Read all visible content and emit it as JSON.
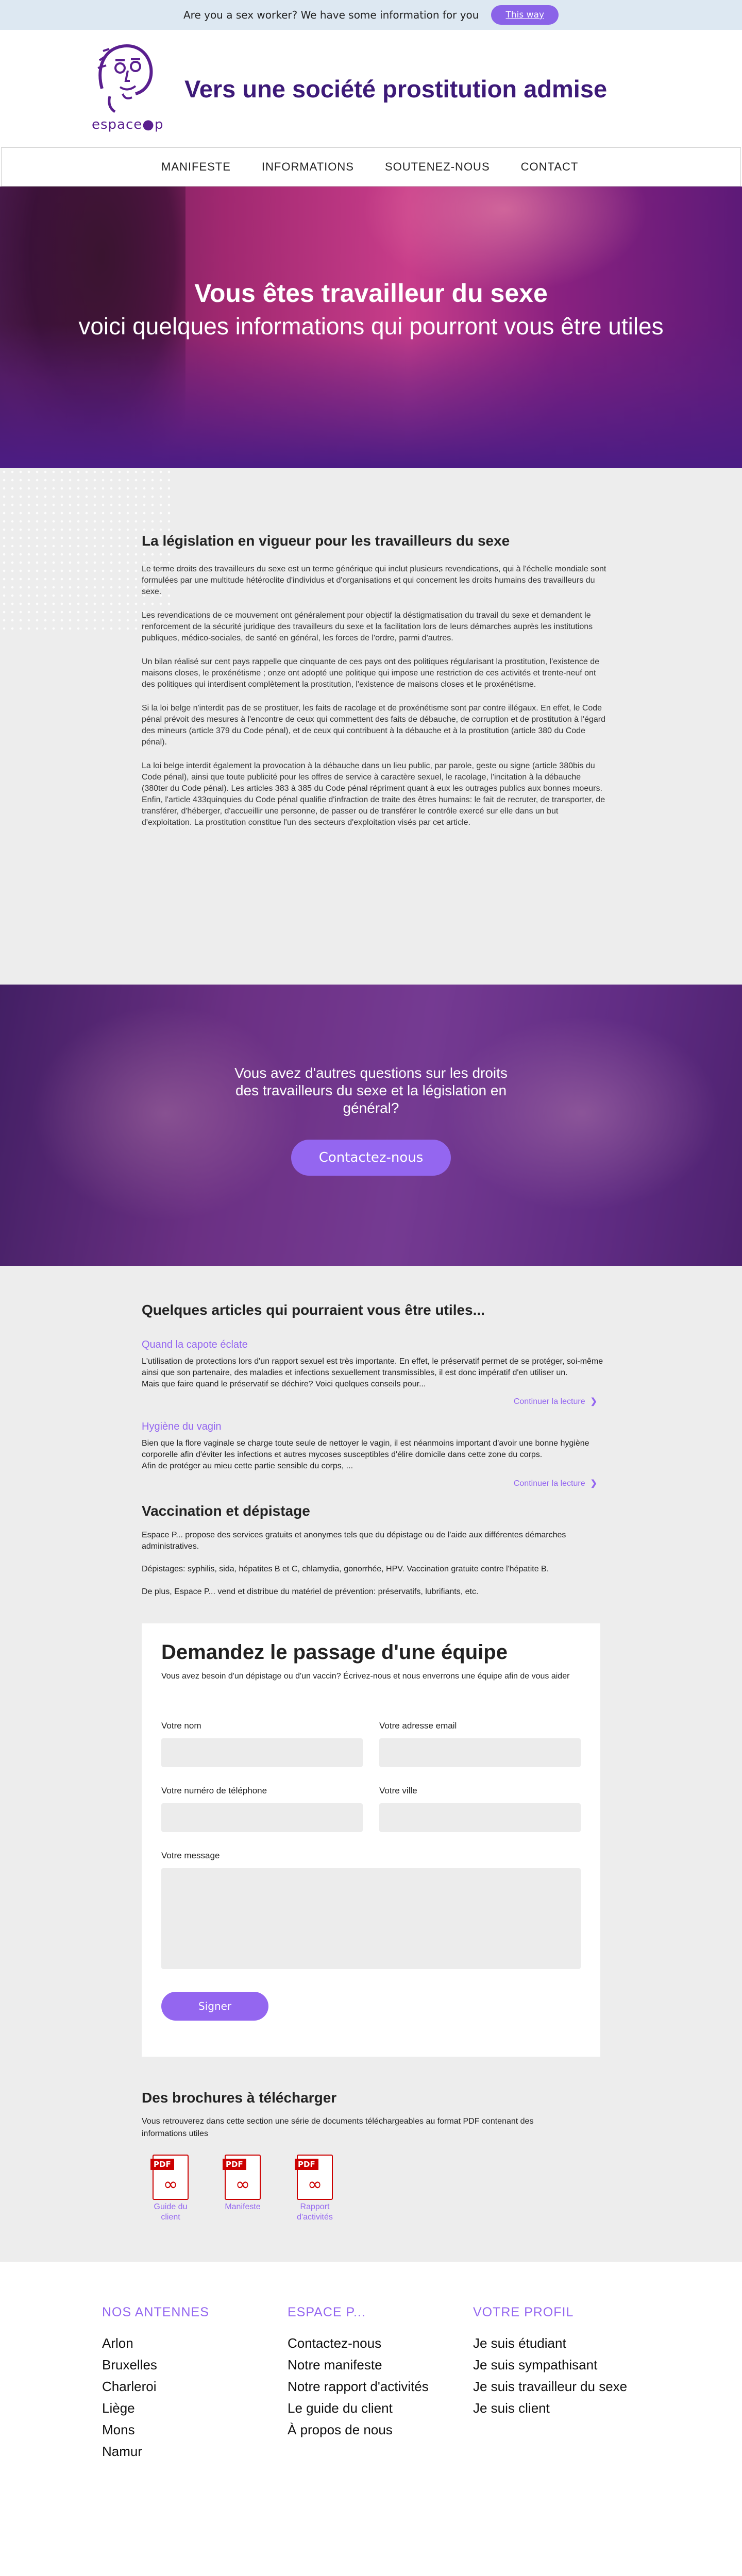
{
  "banner": {
    "text": "Are you a sex worker? We have some information for you",
    "button": "This way"
  },
  "header": {
    "logo_text": "espace●p",
    "title": "Vers une société prostitution admise"
  },
  "nav": [
    "MANIFESTE",
    "INFORMATIONS",
    "SOUTENEZ-NOUS",
    "CONTACT"
  ],
  "hero": {
    "title": "Vous êtes travailleur du sexe",
    "subtitle": "voici quelques informations qui pourront vous être utiles"
  },
  "legislation": {
    "title": "La législation en vigueur pour les travailleurs du sexe",
    "paragraphs": [
      "Le terme droits des travailleurs du sexe est un terme générique qui inclut plusieurs revendications, qui à l'échelle mondiale sont formulées par une multitude hétéroclite d'individus et d'organisations et qui concernent les droits humains des travailleurs du sexe.",
      "Les revendications de ce mouvement ont généralement pour objectif la déstigmatisation du travail du sexe et demandent le renforcement de la sécurité juridique des travailleurs du sexe et la facilitation lors de leurs démarches auprès les institutions publiques, médico-sociales, de santé en général, les forces de l'ordre, parmi d'autres.",
      "Un bilan réalisé sur cent pays rappelle que cinquante de ces pays ont des politiques régularisant la prostitution, l'existence de maisons closes, le proxénétisme ; onze ont adopté une politique qui impose une restriction de ces activités et trente-neuf ont des politiques qui interdisent complètement la prostitution, l'existence de maisons closes et le proxénétisme.",
      "Si la loi belge n'interdit pas de se prostituer, les faits de racolage et de proxénétisme sont par contre illégaux. En effet, le Code pénal prévoit des mesures à l'encontre de ceux qui commettent des faits de débauche, de corruption et de prostitution à l'égard des mineurs (article 379 du Code pénal), et de ceux qui contribuent à la débauche et à la prostitution (article 380 du Code pénal).",
      "La loi belge interdit également la provocation à la débauche dans un lieu public, par parole, geste ou signe (article 380bis du Code pénal), ainsi que toute publicité pour les offres de service à caractère sexuel, le racolage, l'incitation à la débauche (380ter du Code pénal). Les articles 383 à 385 du Code pénal répriment quant à eux les outrages publics aux bonnes moeurs. Enfin, l'article 433quinquies du Code pénal qualifie d'infraction de traite des êtres humains: le fait de recruter, de transporter, de transférer, d'héberger, d'accueillir une personne, de passer ou de transférer le contrôle exercé sur elle dans un but d'exploitation. La prostitution constitue l'un des secteurs d'exploitation visés par cet article."
    ]
  },
  "cta": {
    "text": "Vous avez d'autres questions sur les droits des travailleurs du sexe et la législation en général?",
    "button": "Contactez-nous"
  },
  "articles": {
    "title": "Quelques articles qui pourraient vous être utiles...",
    "items": [
      {
        "title": "Quand la capote éclate",
        "body": "L'utilisation de protections lors d'un rapport sexuel est très importante. En effet, le préservatif permet de se protéger, soi-même ainsi que son partenaire, des maladies et infections sexuellement transmissibles, il est donc impératif d'en utiliser un.\nMais que faire quand le préservatif se déchire? Voici quelques conseils pour...",
        "more": "Continuer la lecture"
      },
      {
        "title": "Hygiène du vagin",
        "body": "Bien que la flore vaginale se charge toute seule de nettoyer le vagin, il est néanmoins important d'avoir une bonne hygiène corporelle afin d'éviter les infections et autres mycoses susceptibles d'élire domicile dans cette zone du corps.\nAfin de protéger au mieu cette partie sensible du corps, ...",
        "more": "Continuer la lecture"
      }
    ]
  },
  "vaccination": {
    "title": "Vaccination et dépistage",
    "paragraphs": [
      "Espace P... propose des services gratuits et anonymes tels que du dépistage ou de l'aide aux différentes démarches administratives.",
      "Dépistages: syphilis, sida, hépatites B et C, chlamydia, gonorrhée, HPV. Vaccination gratuite contre l'hépatite B.",
      "De plus, Espace P... vend et distribue du matériel de prévention: préservatifs, lubrifiants, etc."
    ]
  },
  "form": {
    "title": "Demandez le passage d'une équipe",
    "intro": "Vous avez besoin d'un dépistage ou d'un vaccin? Écrivez-nous et nous enverrons une équipe afin de vous aider",
    "name_label": "Votre nom",
    "email_label": "Votre adresse email",
    "phone_label": "Votre numéro de téléphone",
    "city_label": "Votre ville",
    "message_label": "Votre message",
    "submit": "Signer"
  },
  "brochures": {
    "title": "Des brochures à télécharger",
    "intro": "Vous retrouverez dans cette section une série de documents téléchargeables au format PDF contenant des informations utiles",
    "items": [
      {
        "icon": "pdf-icon",
        "label": "Guide du client"
      },
      {
        "icon": "pdf-icon",
        "label": "Manifeste"
      },
      {
        "icon": "pdf-icon",
        "label": "Rapport d'activités"
      }
    ]
  },
  "footer": {
    "columns": [
      {
        "title": "NOS ANTENNES",
        "items": [
          "Arlon",
          "Bruxelles",
          "Charleroi",
          "Liège",
          "Mons",
          "Namur"
        ]
      },
      {
        "title": "ESPACE P...",
        "items": [
          "Contactez-nous",
          "Notre manifeste",
          "Notre rapport d'activités",
          "Le guide du client",
          "À propos de nous"
        ]
      },
      {
        "title": "VOTRE PROFIL",
        "items": [
          "Je suis étudiant",
          "Je suis sympathisant",
          "Je suis travailleur du sexe",
          "Je suis client"
        ]
      }
    ]
  },
  "colors": {
    "accent": "#9466f0",
    "brand": "#3d1a78",
    "banner_bg": "#dde8f2",
    "section_bg": "#ededed"
  }
}
